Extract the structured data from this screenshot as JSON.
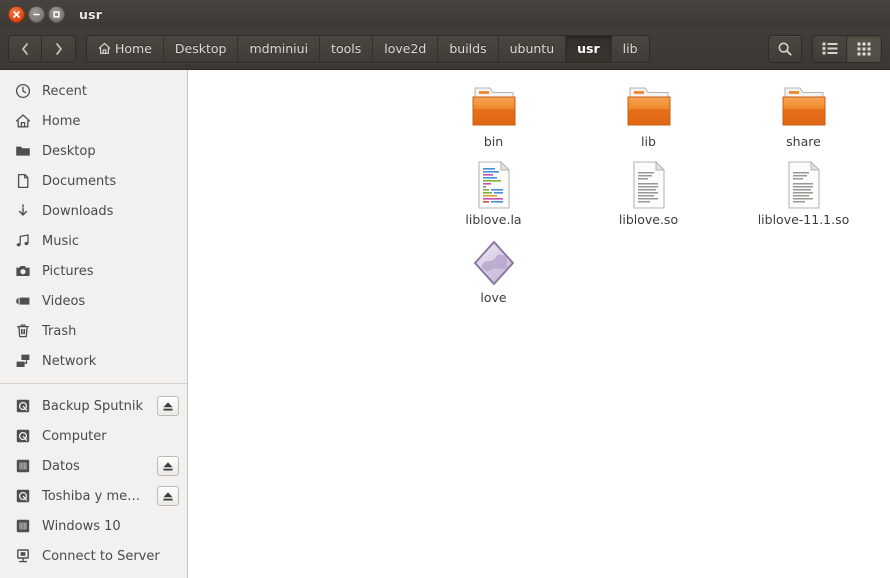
{
  "window": {
    "title": "usr",
    "controls": [
      {
        "name": "close",
        "label": "Close"
      },
      {
        "name": "minimize",
        "label": "Minimize"
      },
      {
        "name": "maximize",
        "label": "Maximize"
      }
    ]
  },
  "toolbar": {
    "back_label": "‹",
    "forward_label": "›",
    "breadcrumbs": [
      {
        "label": "Home",
        "icon": "home-icon",
        "active": false
      },
      {
        "label": "Desktop",
        "icon": "",
        "active": false
      },
      {
        "label": "mdminiui",
        "icon": "",
        "active": false
      },
      {
        "label": "tools",
        "icon": "",
        "active": false
      },
      {
        "label": "love2d",
        "icon": "",
        "active": false
      },
      {
        "label": "builds",
        "icon": "",
        "active": false
      },
      {
        "label": "ubuntu",
        "icon": "",
        "active": false
      },
      {
        "label": "usr",
        "icon": "",
        "active": true
      },
      {
        "label": "lib",
        "icon": "",
        "active": false
      }
    ],
    "search_label": "Search",
    "view_list_label": "List view",
    "view_grid_label": "Icon view",
    "active_view": "grid"
  },
  "sidebar": {
    "items": [
      {
        "label": "Recent",
        "icon": "clock-icon",
        "eject": false
      },
      {
        "label": "Home",
        "icon": "home-icon",
        "eject": false
      },
      {
        "label": "Desktop",
        "icon": "folder-icon",
        "eject": false
      },
      {
        "label": "Documents",
        "icon": "document-icon",
        "eject": false
      },
      {
        "label": "Downloads",
        "icon": "download-icon",
        "eject": false
      },
      {
        "label": "Music",
        "icon": "music-note-icon",
        "eject": false
      },
      {
        "label": "Pictures",
        "icon": "camera-icon",
        "eject": false
      },
      {
        "label": "Videos",
        "icon": "video-camera-icon",
        "eject": false
      },
      {
        "label": "Trash",
        "icon": "trash-icon",
        "eject": false
      },
      {
        "label": "Network",
        "icon": "network-icon",
        "eject": false
      }
    ],
    "devices": [
      {
        "label": "Backup Sputnik",
        "icon": "harddisk-icon",
        "eject": true
      },
      {
        "label": "Computer",
        "icon": "harddisk-icon",
        "eject": false
      },
      {
        "label": "Datos",
        "icon": "drive-icon",
        "eject": true
      },
      {
        "label": "Toshiba y medio",
        "icon": "harddisk-icon",
        "eject": true
      },
      {
        "label": "Windows 10",
        "icon": "drive-icon",
        "eject": false
      },
      {
        "label": "Connect to Server",
        "icon": "server-icon",
        "eject": false
      }
    ],
    "eject_label": "Eject"
  },
  "content": {
    "files": [
      {
        "name": "bin",
        "type": "folder"
      },
      {
        "name": "lib",
        "type": "folder"
      },
      {
        "name": "share",
        "type": "folder"
      },
      {
        "name": "liblove.la",
        "type": "text-color"
      },
      {
        "name": "liblove.so",
        "type": "text-plain"
      },
      {
        "name": "liblove-11.1.so",
        "type": "text-plain"
      },
      {
        "name": "love",
        "type": "executable"
      }
    ]
  },
  "colors": {
    "titlebar": "#413e39",
    "toolbar": "#3f3c37",
    "sidebar": "#f2f1ef",
    "content": "#ffffff",
    "folder": "#f0801f",
    "close_button": "#dd4814",
    "text_dark": "#4a4a4c",
    "text_light": "#dedbd6",
    "executable": "#b9a9cc"
  }
}
